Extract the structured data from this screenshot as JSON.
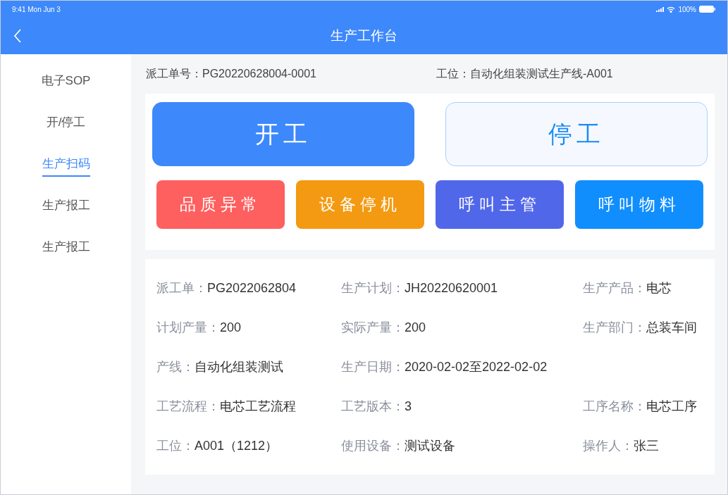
{
  "status_bar": {
    "time": "9:41  Mon Jun 3",
    "battery": "100%"
  },
  "header": {
    "title": "生产工作台"
  },
  "sidebar": {
    "items": [
      {
        "label": "电子SOP",
        "selected": false
      },
      {
        "label": "开/停工",
        "selected": false
      },
      {
        "label": "生产扫码",
        "selected": true
      },
      {
        "label": "生产报工",
        "selected": false
      },
      {
        "label": "生产报工",
        "selected": false
      }
    ]
  },
  "info": {
    "order": "派工单号：PG20220628004-0001",
    "station": "工位：自动化组装测试生产线-A001"
  },
  "main_buttons": [
    {
      "label": "开工",
      "kind": "filled"
    },
    {
      "label": "停工",
      "kind": "outline"
    }
  ],
  "action_buttons": [
    {
      "label": "品质异常",
      "color": "#fe5f5f"
    },
    {
      "label": "设备停机",
      "color": "#f39a12"
    },
    {
      "label": "呼叫主管",
      "color": "#5167ea"
    },
    {
      "label": "呼叫物料",
      "color": "#108efe"
    }
  ],
  "details": [
    [
      {
        "label": "派工单：",
        "value": "PG2022062804"
      },
      {
        "label": "生产计划：",
        "value": "JH20220620001"
      },
      {
        "label": "生产产品：",
        "value": "电芯"
      }
    ],
    [
      {
        "label": "计划产量：",
        "value": "200"
      },
      {
        "label": "实际产量：",
        "value": "200"
      },
      {
        "label": "生产部门：",
        "value": "总装车间"
      }
    ],
    [
      {
        "label": "产线：",
        "value": "自动化组装测试"
      },
      {
        "label": "生产日期：",
        "value": "2020-02-02至2022-02-02"
      }
    ],
    [
      {
        "label": "工艺流程：",
        "value": "电芯工艺流程"
      },
      {
        "label": "工艺版本：",
        "value": "3"
      },
      {
        "label": "工序名称：",
        "value": "电芯工序"
      }
    ],
    [
      {
        "label": "工位：",
        "value": "A001（1212）"
      },
      {
        "label": "使用设备：",
        "value": "测试设备"
      },
      {
        "label": "操作人：",
        "value": "张三"
      }
    ]
  ]
}
